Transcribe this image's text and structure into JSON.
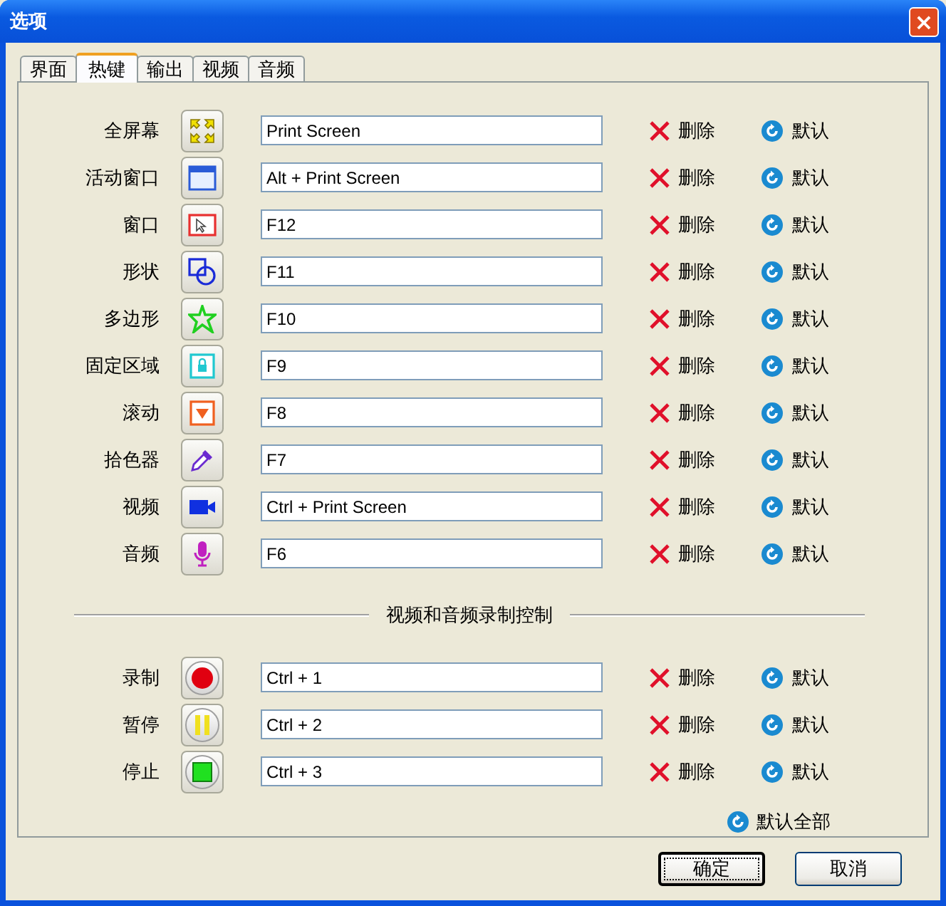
{
  "window": {
    "title": "选项",
    "close": "×"
  },
  "tabs": [
    {
      "label": "界面",
      "selected": false
    },
    {
      "label": "热键",
      "selected": true
    },
    {
      "label": "输出",
      "selected": false
    },
    {
      "label": "视频",
      "selected": false
    },
    {
      "label": "音频",
      "selected": false
    }
  ],
  "hotkeys": [
    {
      "label": "全屏幕",
      "value": "Print Screen",
      "delete": "删除",
      "default": "默认"
    },
    {
      "label": "活动窗口",
      "value": "Alt + Print Screen",
      "delete": "删除",
      "default": "默认"
    },
    {
      "label": "窗口",
      "value": "F12",
      "delete": "删除",
      "default": "默认"
    },
    {
      "label": "形状",
      "value": "F11",
      "delete": "删除",
      "default": "默认"
    },
    {
      "label": "多边形",
      "value": "F10",
      "delete": "删除",
      "default": "默认"
    },
    {
      "label": "固定区域",
      "value": "F9",
      "delete": "删除",
      "default": "默认"
    },
    {
      "label": "滚动",
      "value": "F8",
      "delete": "删除",
      "default": "默认"
    },
    {
      "label": "拾色器",
      "value": "F7",
      "delete": "删除",
      "default": "默认"
    },
    {
      "label": "视频",
      "value": "Ctrl + Print Screen",
      "delete": "删除",
      "default": "默认"
    },
    {
      "label": "音频",
      "value": "F6",
      "delete": "删除",
      "default": "默认"
    }
  ],
  "section_title": "视频和音频录制控制",
  "recording": [
    {
      "label": "录制",
      "value": "Ctrl + 1",
      "delete": "删除",
      "default": "默认"
    },
    {
      "label": "暂停",
      "value": "Ctrl + 2",
      "delete": "删除",
      "default": "默认"
    },
    {
      "label": "停止",
      "value": "Ctrl + 3",
      "delete": "删除",
      "default": "默认"
    }
  ],
  "default_all": "默认全部",
  "buttons": [
    {
      "label": "确定",
      "default": true
    },
    {
      "label": "取消",
      "default": false
    }
  ]
}
